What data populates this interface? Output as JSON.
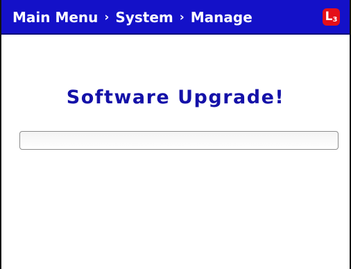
{
  "header": {
    "breadcrumb": [
      "Main Menu",
      "System",
      "Manage"
    ],
    "separator": "›",
    "logo": {
      "letter": "L",
      "digit": "3",
      "color": "#e50f18"
    },
    "background_color": "#1411c8"
  },
  "main": {
    "title": "Software Upgrade!",
    "title_color": "#1411a8",
    "progress": {
      "value_fraction": 0
    }
  }
}
